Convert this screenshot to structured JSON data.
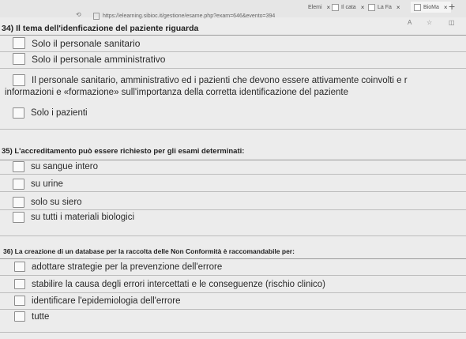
{
  "browser": {
    "tabs": [
      {
        "label": "Elemi",
        "close": "×"
      },
      {
        "label": "Il cata",
        "close": "×"
      },
      {
        "label": "La Fa",
        "close": "×"
      },
      {
        "label": "BioMa",
        "close": "×"
      }
    ],
    "new_tab": "+",
    "url": "https://elearning.sibioc.it/gestione/esame.php?exam=646&evento=394",
    "reader_icon": "A",
    "star_icon": "☆",
    "book_icon": "◫"
  },
  "questions": [
    {
      "number": "34)",
      "title": "Il tema dell'idenficazione del paziente riguarda",
      "options": [
        "Solo il personale sanitario",
        "Solo il personale amministrativo",
        "Il personale sanitario, amministrativo ed i pazienti che devono essere attivamente coinvolti e r",
        "informazioni e «formazione» sull'importanza della corretta identificazione del paziente",
        "Solo i pazienti"
      ]
    },
    {
      "number": "35)",
      "title": "L'accreditamento può essere richiesto per gli esami determinati:",
      "options": [
        "su sangue intero",
        "su urine",
        "solo su siero",
        "su tutti i materiali biologici"
      ]
    },
    {
      "number": "36)",
      "title": "La creazione di un database per la raccolta delle Non Conformità è raccomandabile per:",
      "options": [
        "adottare strategie per la prevenzione dell'errore",
        "stabilire la causa degli errori intercettati e le conseguenze (rischio clinico)",
        "identificare l'epidemiologia dell'errore",
        "tutte"
      ]
    }
  ]
}
